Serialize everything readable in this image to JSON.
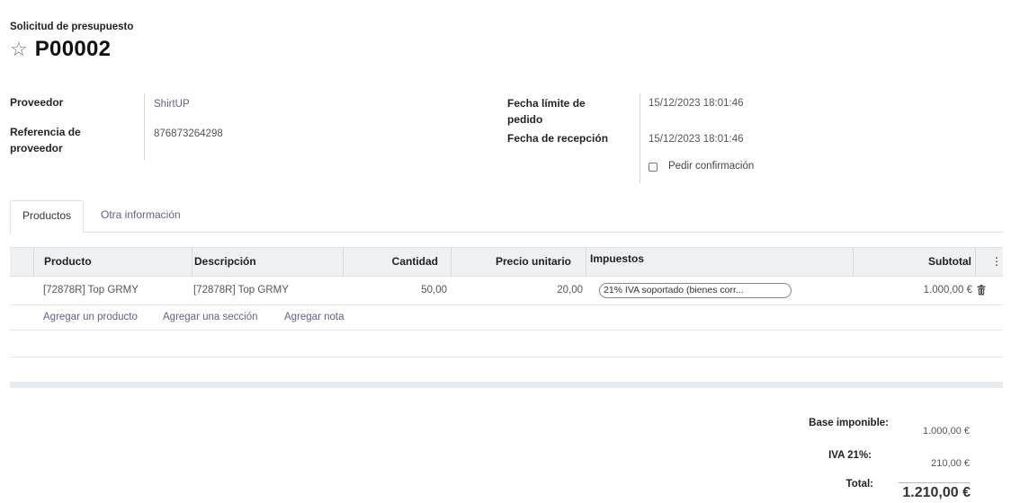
{
  "header": {
    "subtitle": "Solicitud de presupuesto",
    "title": "P00002",
    "star_icon": "☆"
  },
  "form": {
    "vendor_label": "Proveedor",
    "vendor_value": "ShirtUP",
    "vendor_ref_label": "Referencia de proveedor",
    "vendor_ref_value": "876873264298",
    "deadline_label": "Fecha límite de pedido",
    "deadline_value": "15/12/2023 18:01:46",
    "receipt_label": "Fecha de recepción",
    "receipt_value": "15/12/2023 18:01:46",
    "ask_confirmation_label": "Pedir confirmación",
    "ask_confirmation_checked": false
  },
  "tabs": [
    {
      "label": "Productos",
      "active": true
    },
    {
      "label": "Otra información",
      "active": false
    }
  ],
  "table": {
    "columns": {
      "product": "Producto",
      "description": "Descripción",
      "quantity": "Cantidad",
      "unit_price": "Precio unitario",
      "taxes": "Impuestos",
      "subtotal": "Subtotal",
      "options_icon": "⋮"
    },
    "rows": [
      {
        "product": "[72878R] Top GRMY",
        "description": "[72878R] Top GRMY",
        "quantity": "50,00",
        "unit_price": "20,00",
        "tax": "21% IVA soportado (bienes corr...",
        "subtotal": "1.000,00 €"
      }
    ],
    "add_product": "Agregar un producto",
    "add_section": "Agregar una sección",
    "add_note": "Agregar nota"
  },
  "totals": {
    "base_label": "Base imponible:",
    "base_value": "1.000,00 €",
    "tax_label": "IVA 21%:",
    "tax_value": "210,00 €",
    "total_label": "Total:",
    "total_value": "1.210,00 €"
  },
  "colors": {
    "link": "#6b5b8c",
    "header_bg": "#eef0f2"
  }
}
